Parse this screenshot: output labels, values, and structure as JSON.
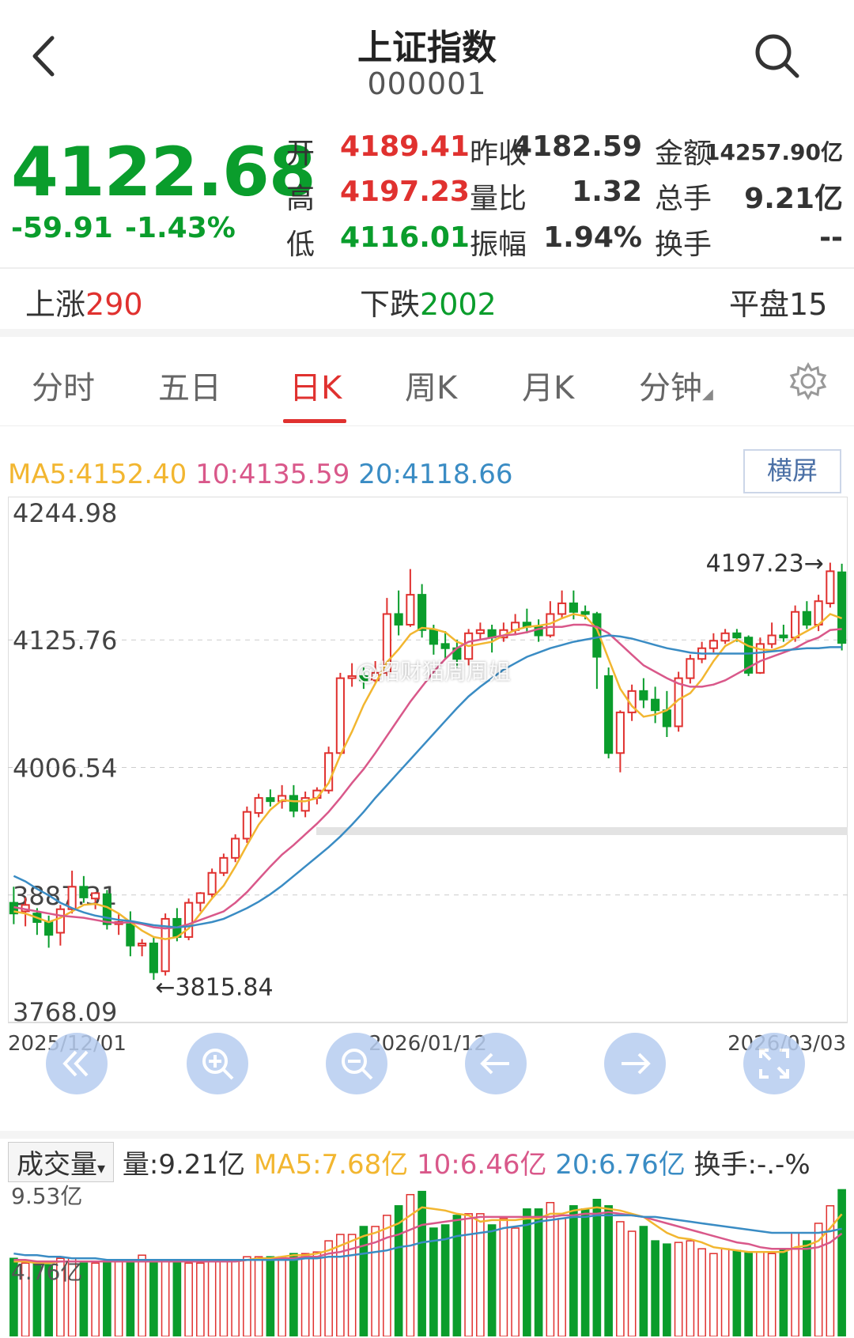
{
  "header": {
    "title": "上证指数",
    "code": "000001",
    "back_icon": "chevron-left-icon",
    "search_icon": "search-icon"
  },
  "quote": {
    "price": "4122.68",
    "change": "-59.91",
    "change_pct": "-1.43%",
    "rows": [
      [
        {
          "label": "开",
          "value": "4189.41",
          "color": "red"
        },
        {
          "label": "昨收",
          "value": "4182.59",
          "color": "dark"
        },
        {
          "label": "金额",
          "value": "14257.90亿",
          "color": "dark"
        }
      ],
      [
        {
          "label": "高",
          "value": "4197.23",
          "color": "red"
        },
        {
          "label": "量比",
          "value": "1.32",
          "color": "dark"
        },
        {
          "label": "总手",
          "value": "9.21亿",
          "color": "dark"
        }
      ],
      [
        {
          "label": "低",
          "value": "4116.01",
          "color": "green"
        },
        {
          "label": "振幅",
          "value": "1.94%",
          "color": "dark"
        },
        {
          "label": "换手",
          "value": "--",
          "color": "dark"
        }
      ]
    ]
  },
  "breadth": {
    "up_label": "上涨",
    "up_value": "290",
    "down_label": "下跌",
    "down_value": "2002",
    "flat_label": "平盘",
    "flat_value": "15"
  },
  "tabs": [
    {
      "label": "分时",
      "active": false
    },
    {
      "label": "五日",
      "active": false
    },
    {
      "label": "日K",
      "active": true
    },
    {
      "label": "周K",
      "active": false
    },
    {
      "label": "月K",
      "active": false
    },
    {
      "label": "分钟",
      "active": false
    }
  ],
  "settings_icon": "gear-icon",
  "ma": {
    "ma5": "MA5:4152.40",
    "ma10": "10:4135.59",
    "ma20": "20:4118.66",
    "landscape": "横屏"
  },
  "watermark": "@招财猫周周姐",
  "colors": {
    "up": "#e0312f",
    "down": "#0a9d2c",
    "ma5": "#f2b630",
    "ma10": "#d9588a",
    "ma20": "#3a8cc4"
  },
  "chart_data": [
    {
      "type": "candlestick",
      "y_ticks": [
        "4244.98",
        "4125.76",
        "4006.54",
        "3887.31",
        "3768.09"
      ],
      "ylim": [
        3768.09,
        4244.98
      ],
      "x_ticks": [
        "2025/12/01",
        "2026/01/12",
        "2026/03/03"
      ],
      "annotations": {
        "high": "4197.23",
        "low": "3815.84"
      },
      "candles": [
        [
          3880,
          3870,
          3895,
          3860
        ],
        [
          3872,
          3878,
          3885,
          3858
        ],
        [
          3870,
          3862,
          3875,
          3850
        ],
        [
          3862,
          3850,
          3868,
          3838
        ],
        [
          3852,
          3874,
          3878,
          3840
        ],
        [
          3874,
          3895,
          3910,
          3870
        ],
        [
          3895,
          3885,
          3905,
          3880
        ],
        [
          3884,
          3889,
          3890,
          3874
        ],
        [
          3888,
          3860,
          3892,
          3855
        ],
        [
          3860,
          3862,
          3870,
          3850
        ],
        [
          3860,
          3840,
          3872,
          3830
        ],
        [
          3840,
          3842,
          3846,
          3830
        ],
        [
          3842,
          3815,
          3848,
          3808
        ],
        [
          3816,
          3865,
          3870,
          3812
        ],
        [
          3865,
          3848,
          3875,
          3844
        ],
        [
          3848,
          3880,
          3884,
          3845
        ],
        [
          3880,
          3889,
          3890,
          3872
        ],
        [
          3888,
          3908,
          3912,
          3885
        ],
        [
          3908,
          3922,
          3926,
          3905
        ],
        [
          3922,
          3940,
          3944,
          3918
        ],
        [
          3940,
          3965,
          3970,
          3936
        ],
        [
          3964,
          3978,
          3982,
          3960
        ],
        [
          3978,
          3975,
          3986,
          3970
        ],
        [
          3975,
          3980,
          3990,
          3968
        ],
        [
          3980,
          3966,
          3990,
          3960
        ],
        [
          3966,
          3978,
          3984,
          3960
        ],
        [
          3978,
          3985,
          3988,
          3972
        ],
        [
          3985,
          4020,
          4026,
          3982
        ],
        [
          4020,
          4090,
          4095,
          4018
        ],
        [
          4090,
          4092,
          4104,
          4082
        ],
        [
          4092,
          4088,
          4100,
          4080
        ],
        [
          4088,
          4095,
          4106,
          4086
        ],
        [
          4095,
          4150,
          4165,
          4092
        ],
        [
          4150,
          4140,
          4172,
          4130
        ],
        [
          4140,
          4168,
          4192,
          4138
        ],
        [
          4168,
          4135,
          4178,
          4128
        ],
        [
          4135,
          4122,
          4140,
          4112
        ],
        [
          4122,
          4118,
          4134,
          4108
        ],
        [
          4118,
          4108,
          4126,
          4100
        ],
        [
          4108,
          4132,
          4136,
          4102
        ],
        [
          4132,
          4135,
          4142,
          4126
        ],
        [
          4135,
          4128,
          4140,
          4114
        ],
        [
          4128,
          4135,
          4142,
          4124
        ],
        [
          4135,
          4142,
          4150,
          4130
        ],
        [
          4142,
          4138,
          4155,
          4132
        ],
        [
          4138,
          4130,
          4145,
          4124
        ],
        [
          4130,
          4150,
          4162,
          4128
        ],
        [
          4150,
          4160,
          4172,
          4146
        ],
        [
          4160,
          4152,
          4172,
          4145
        ],
        [
          4152,
          4150,
          4158,
          4145
        ],
        [
          4150,
          4110,
          4152,
          4080
        ],
        [
          4092,
          4020,
          4100,
          4015
        ],
        [
          4020,
          4058,
          4060,
          4002
        ],
        [
          4058,
          4078,
          4084,
          4050
        ],
        [
          4078,
          4070,
          4090,
          4062
        ],
        [
          4070,
          4060,
          4082,
          4048
        ],
        [
          4060,
          4045,
          4078,
          4035
        ],
        [
          4045,
          4090,
          4096,
          4040
        ],
        [
          4090,
          4108,
          4112,
          4085
        ],
        [
          4108,
          4118,
          4124,
          4104
        ],
        [
          4118,
          4125,
          4132,
          4114
        ],
        [
          4125,
          4132,
          4136,
          4122
        ],
        [
          4132,
          4128,
          4136,
          4124
        ],
        [
          4128,
          4095,
          4130,
          4092
        ],
        [
          4095,
          4122,
          4128,
          4094
        ],
        [
          4122,
          4130,
          4142,
          4118
        ],
        [
          4130,
          4128,
          4140,
          4124
        ],
        [
          4128,
          4152,
          4158,
          4124
        ],
        [
          4152,
          4140,
          4162,
          4136
        ],
        [
          4140,
          4162,
          4168,
          4134
        ],
        [
          4160,
          4190,
          4198,
          4156
        ],
        [
          4189,
          4123,
          4197,
          4116
        ]
      ],
      "ma5": [
        3872,
        3870,
        3866,
        3862,
        3866,
        3872,
        3878,
        3879,
        3876,
        3870,
        3862,
        3854,
        3848,
        3846,
        3848,
        3856,
        3870,
        3884,
        3896,
        3914,
        3934,
        3953,
        3967,
        3976,
        3975,
        3975,
        3978,
        3992,
        4018,
        4040,
        4065,
        4085,
        4105,
        4117,
        4131,
        4137,
        4136,
        4133,
        4124,
        4120,
        4122,
        4124,
        4130,
        4135,
        4138,
        4139,
        4141,
        4146,
        4150,
        4148,
        4136,
        4108,
        4080,
        4064,
        4054,
        4056,
        4060,
        4070,
        4076,
        4089,
        4106,
        4120,
        4126,
        4120,
        4117,
        4116,
        4120,
        4128,
        4134,
        4140,
        4150,
        4146
      ],
      "ma10": [
        3876,
        3874,
        3872,
        3870,
        3868,
        3867,
        3866,
        3864,
        3862,
        3861,
        3862,
        3860,
        3857,
        3856,
        3857,
        3860,
        3864,
        3868,
        3872,
        3880,
        3890,
        3902,
        3914,
        3925,
        3934,
        3944,
        3954,
        3965,
        3978,
        3992,
        4005,
        4020,
        4036,
        4052,
        4068,
        4082,
        4096,
        4108,
        4118,
        4124,
        4126,
        4128,
        4130,
        4131,
        4133,
        4136,
        4138,
        4138,
        4140,
        4140,
        4138,
        4132,
        4122,
        4112,
        4102,
        4096,
        4090,
        4085,
        4082,
        4082,
        4084,
        4088,
        4094,
        4100,
        4106,
        4110,
        4114,
        4118,
        4124,
        4128,
        4135,
        4136
      ],
      "ma20": [
        3905,
        3900,
        3893,
        3887,
        3880,
        3875,
        3871,
        3868,
        3866,
        3864,
        3863,
        3861,
        3859,
        3858,
        3857,
        3858,
        3860,
        3862,
        3865,
        3870,
        3875,
        3881,
        3888,
        3896,
        3905,
        3914,
        3923,
        3932,
        3942,
        3953,
        3965,
        3978,
        3990,
        4002,
        4014,
        4026,
        4038,
        4050,
        4062,
        4073,
        4082,
        4090,
        4098,
        4104,
        4110,
        4114,
        4118,
        4121,
        4124,
        4126,
        4128,
        4130,
        4129,
        4127,
        4124,
        4121,
        4118,
        4116,
        4114,
        4113,
        4113,
        4113,
        4113,
        4113,
        4114,
        4115,
        4116,
        4117,
        4118,
        4118,
        4119,
        4119
      ]
    },
    {
      "type": "bar",
      "title": "成交量",
      "stats": {
        "vol": "量:9.21亿",
        "ma5": "MA5:7.68亿",
        "ma10": "10:6.46亿",
        "ma20": "20:6.76亿",
        "turnover": "换手:-.-%"
      },
      "y_ticks": [
        "9.53亿",
        "4.76亿"
      ],
      "ylim": [
        0,
        9.53
      ],
      "values": [
        4.9,
        4.6,
        4.6,
        4.5,
        4.9,
        4.9,
        4.6,
        4.6,
        4.7,
        4.7,
        4.8,
        5.1,
        4.8,
        4.8,
        4.8,
        4.6,
        4.6,
        4.8,
        4.8,
        4.8,
        5.0,
        5.0,
        5.0,
        5.0,
        5.2,
        5.2,
        5.3,
        6.0,
        6.4,
        6.4,
        6.9,
        6.9,
        7.6,
        8.2,
        8.9,
        9.1,
        6.8,
        7.0,
        7.6,
        7.7,
        7.7,
        7.0,
        7.4,
        6.8,
        8.0,
        8.0,
        8.4,
        7.4,
        8.2,
        8.0,
        8.6,
        8.2,
        7.2,
        6.6,
        6.9,
        6.0,
        5.8,
        5.9,
        6.0,
        5.5,
        5.2,
        5.5,
        5.4,
        5.3,
        5.3,
        5.2,
        5.4,
        6.5,
        6.0,
        7.1,
        8.2,
        9.21
      ],
      "ma5": [
        4.7,
        4.7,
        4.6,
        4.6,
        4.7,
        4.7,
        4.7,
        4.7,
        4.7,
        4.7,
        4.7,
        4.8,
        4.8,
        4.8,
        4.8,
        4.8,
        4.7,
        4.7,
        4.8,
        4.7,
        4.8,
        4.9,
        4.9,
        5.0,
        5.1,
        5.1,
        5.2,
        5.4,
        5.7,
        6.0,
        6.3,
        6.5,
        6.8,
        7.1,
        7.6,
        8.1,
        8.0,
        7.9,
        7.7,
        7.6,
        7.2,
        7.3,
        7.3,
        7.3,
        7.4,
        7.4,
        7.7,
        7.7,
        7.9,
        8.0,
        8.1,
        8.0,
        7.9,
        7.7,
        7.5,
        7.0,
        6.5,
        6.2,
        6.1,
        5.9,
        5.6,
        5.5,
        5.4,
        5.3,
        5.3,
        5.3,
        5.3,
        5.6,
        5.7,
        6.0,
        6.8,
        7.68
      ],
      "ma10": [
        4.8,
        4.8,
        4.7,
        4.7,
        4.7,
        4.7,
        4.7,
        4.7,
        4.7,
        4.7,
        4.7,
        4.7,
        4.7,
        4.7,
        4.7,
        4.7,
        4.7,
        4.7,
        4.7,
        4.7,
        4.8,
        4.8,
        4.8,
        4.9,
        4.9,
        5.0,
        5.0,
        5.2,
        5.3,
        5.5,
        5.7,
        5.9,
        6.2,
        6.4,
        6.7,
        7.0,
        7.1,
        7.2,
        7.3,
        7.4,
        7.5,
        7.5,
        7.5,
        7.5,
        7.5,
        7.5,
        7.5,
        7.6,
        7.6,
        7.7,
        7.7,
        7.8,
        7.7,
        7.6,
        7.5,
        7.3,
        7.1,
        6.9,
        6.7,
        6.5,
        6.3,
        6.1,
        5.9,
        5.8,
        5.6,
        5.5,
        5.5,
        5.5,
        5.5,
        5.6,
        5.9,
        6.46
      ],
      "ma20": [
        5.2,
        5.1,
        5.1,
        5.0,
        5.0,
        4.9,
        4.9,
        4.9,
        4.8,
        4.8,
        4.8,
        4.8,
        4.8,
        4.8,
        4.8,
        4.8,
        4.8,
        4.8,
        4.8,
        4.8,
        4.8,
        4.8,
        4.8,
        4.8,
        4.8,
        4.9,
        4.9,
        5.0,
        5.0,
        5.1,
        5.2,
        5.3,
        5.4,
        5.6,
        5.7,
        5.9,
        6.0,
        6.1,
        6.3,
        6.4,
        6.5,
        6.6,
        6.8,
        6.9,
        7.0,
        7.2,
        7.3,
        7.4,
        7.5,
        7.5,
        7.6,
        7.6,
        7.6,
        7.6,
        7.5,
        7.5,
        7.4,
        7.3,
        7.2,
        7.1,
        7.0,
        6.9,
        6.8,
        6.7,
        6.6,
        6.5,
        6.5,
        6.5,
        6.5,
        6.5,
        6.6,
        6.76
      ]
    }
  ]
}
